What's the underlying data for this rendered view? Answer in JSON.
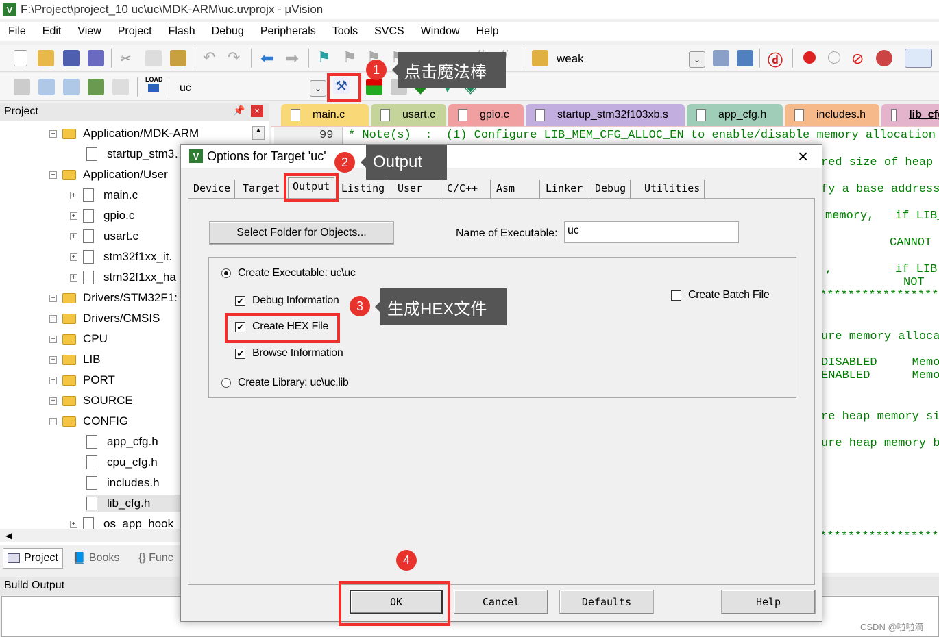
{
  "window": {
    "title": "F:\\Project\\project_10 uc\\uc\\MDK-ARM\\uc.uvprojx - µVision"
  },
  "menu": [
    "File",
    "Edit",
    "View",
    "Project",
    "Flash",
    "Debug",
    "Peripherals",
    "Tools",
    "SVCS",
    "Window",
    "Help"
  ],
  "toolbar": {
    "find_value": "weak",
    "target_value": "uc",
    "load_label": "LOAD"
  },
  "project_panel": {
    "title": "Project",
    "items": [
      {
        "label": "Application/MDK-ARM",
        "type": "folder",
        "expanded": true
      },
      {
        "label": "startup_stm3…",
        "type": "file"
      },
      {
        "label": "Application/User",
        "type": "folder",
        "expanded": true
      },
      {
        "label": "main.c",
        "type": "file-plus"
      },
      {
        "label": "gpio.c",
        "type": "file-plus"
      },
      {
        "label": "usart.c",
        "type": "file-plus"
      },
      {
        "label": "stm32f1xx_it.",
        "type": "file-plus"
      },
      {
        "label": "stm32f1xx_ha",
        "type": "file-plus"
      },
      {
        "label": "Drivers/STM32F1:",
        "type": "folder"
      },
      {
        "label": "Drivers/CMSIS",
        "type": "folder"
      },
      {
        "label": "CPU",
        "type": "folder"
      },
      {
        "label": "LIB",
        "type": "folder"
      },
      {
        "label": "PORT",
        "type": "folder"
      },
      {
        "label": "SOURCE",
        "type": "folder"
      },
      {
        "label": "CONFIG",
        "type": "folder",
        "expanded": true
      },
      {
        "label": "app_cfg.h",
        "type": "file"
      },
      {
        "label": "cpu_cfg.h",
        "type": "file"
      },
      {
        "label": "includes.h",
        "type": "file"
      },
      {
        "label": "lib_cfg.h",
        "type": "file",
        "selected": true
      },
      {
        "label": "os_app_hook",
        "type": "file-plus"
      }
    ],
    "tabs": [
      "Project",
      "Books",
      "{} Func"
    ]
  },
  "editor": {
    "tabs": [
      {
        "label": "main.c",
        "color": "#f9d977"
      },
      {
        "label": "usart.c",
        "color": "#c5d49a"
      },
      {
        "label": "gpio.c",
        "color": "#f0a0a0"
      },
      {
        "label": "startup_stm32f103xb.s",
        "color": "#c3aee0"
      },
      {
        "label": "app_cfg.h",
        "color": "#9fcdb8"
      },
      {
        "label": "includes.h",
        "color": "#f5b98a"
      },
      {
        "label": "lib_cfg.h",
        "color": "#e4b4cc"
      }
    ],
    "line_number": "99",
    "first_line": "* Note(s)  :  (1) Configure LIB_MEM_CFG_ALLOC_EN to enable/disable memory allocation",
    "right_lines": [
      "red size of heap",
      "fy a base address",
      "memory,   if LIB_",
      "CANNOT",
      ",         if LIB_",
      "NOT",
      "******************",
      "ure memory alloca",
      "DISABLED     Memo",
      "ENABLED      Memo",
      "re heap memory si",
      "ure heap memory b",
      "******************"
    ]
  },
  "build_output": {
    "title": "Build Output"
  },
  "dialog": {
    "title": "Options for Target 'uc'",
    "tabs": [
      "Device",
      "Target",
      "Output",
      "Listing",
      "User",
      "C/C++",
      "Asm",
      "Linker",
      "Debug",
      "Utilities"
    ],
    "active_tab": "Output",
    "select_folder": "Select Folder for Objects...",
    "name_label": "Name of Executable:",
    "name_value": "uc",
    "create_exe": "Create Executable:  uc\\uc",
    "debug_info": "Debug Information",
    "create_hex": "Create HEX File",
    "browse_info": "Browse Information",
    "create_lib": "Create Library:  uc\\uc.lib",
    "batch": "Create Batch File",
    "checks": {
      "create_exe": true,
      "debug_info": true,
      "create_hex": true,
      "browse_info": true,
      "create_lib": false,
      "batch": false
    },
    "ok": "OK",
    "cancel": "Cancel",
    "defaults": "Defaults",
    "help": "Help"
  },
  "annotations": [
    {
      "n": "1",
      "text": "点击魔法棒"
    },
    {
      "n": "2",
      "text": "Output"
    },
    {
      "n": "3",
      "text": "生成HEX文件"
    },
    {
      "n": "4",
      "text": ""
    }
  ],
  "watermark": "CSDN @啦啦滴"
}
